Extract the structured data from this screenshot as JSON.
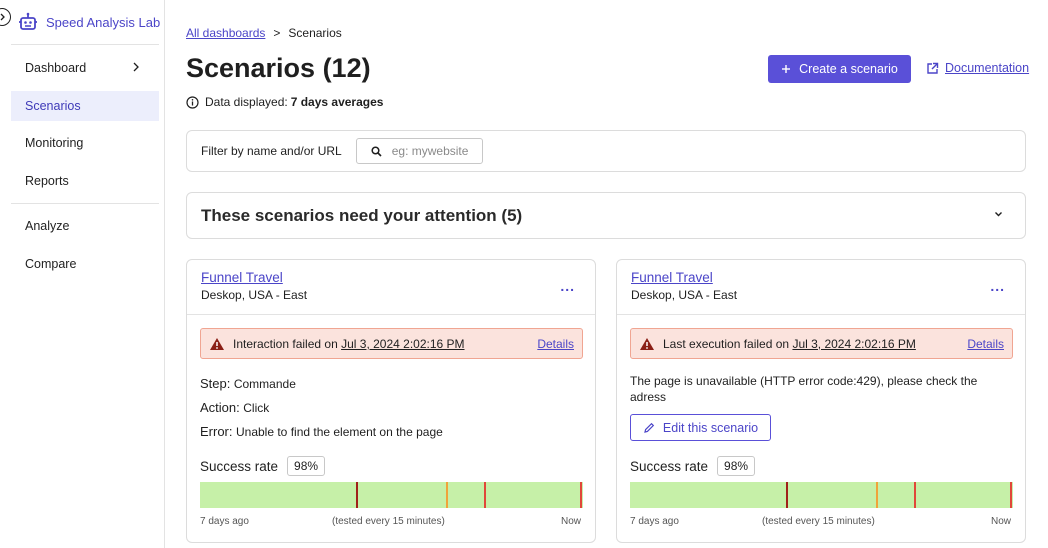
{
  "sidebar": {
    "brand": "Speed Analysis Lab",
    "items": [
      {
        "label": "Dashboard"
      },
      {
        "label": "Scenarios"
      },
      {
        "label": "Monitoring"
      },
      {
        "label": "Reports"
      },
      {
        "label": "Analyze"
      },
      {
        "label": "Compare"
      }
    ]
  },
  "breadcrumb": {
    "parent": "All dashboards",
    "separator": ">",
    "current": "Scenarios"
  },
  "header": {
    "title": "Scenarios (12)",
    "info_prefix": "Data displayed:",
    "info_value": "7 days averages",
    "create_label": "Create a scenario",
    "documentation_label": "Documentation"
  },
  "filter": {
    "label": "Filter by name and/or URL",
    "placeholder": "eg: mywebsite"
  },
  "attention": {
    "title": "These scenarios need your attention (5)"
  },
  "colors": {
    "accent": "#5a50d8",
    "link": "#4b45c8",
    "alert_bg": "#fbe3dd",
    "bar_green": "#c6f0a8",
    "tick_dark": "#a0211a",
    "tick_orange": "#f0a33a",
    "tick_red": "#e0473a"
  },
  "cards": [
    {
      "title": "Funnel Travel",
      "subtitle": "Deskop, USA - East",
      "more": "...",
      "alert_prefix": "Interaction failed on",
      "alert_time": "Jul 3, 2024 2:02:16 PM",
      "details": "Details",
      "step_label": "Step:",
      "step_value": "Commande",
      "action_label": "Action:",
      "action_value": "Click",
      "error_label": "Error:",
      "error_value": "Unable to find the element on the page",
      "success_label": "Success rate",
      "success_value": "98%",
      "foot_left": "7 days ago",
      "foot_mid": "(tested every 15 minutes)",
      "foot_right": "Now"
    },
    {
      "title": "Funnel Travel",
      "subtitle": "Deskop, USA - East",
      "more": "...",
      "alert_prefix": "Last execution failed on",
      "alert_time": "Jul 3, 2024 2:02:16 PM",
      "details": "Details",
      "message": "The page is unavailable (HTTP error code:429), please check the adress",
      "edit_label": "Edit this scenario",
      "success_label": "Success rate",
      "success_value": "98%",
      "foot_left": "7 days ago",
      "foot_mid": "(tested every 15 minutes)",
      "foot_right": "Now"
    }
  ]
}
